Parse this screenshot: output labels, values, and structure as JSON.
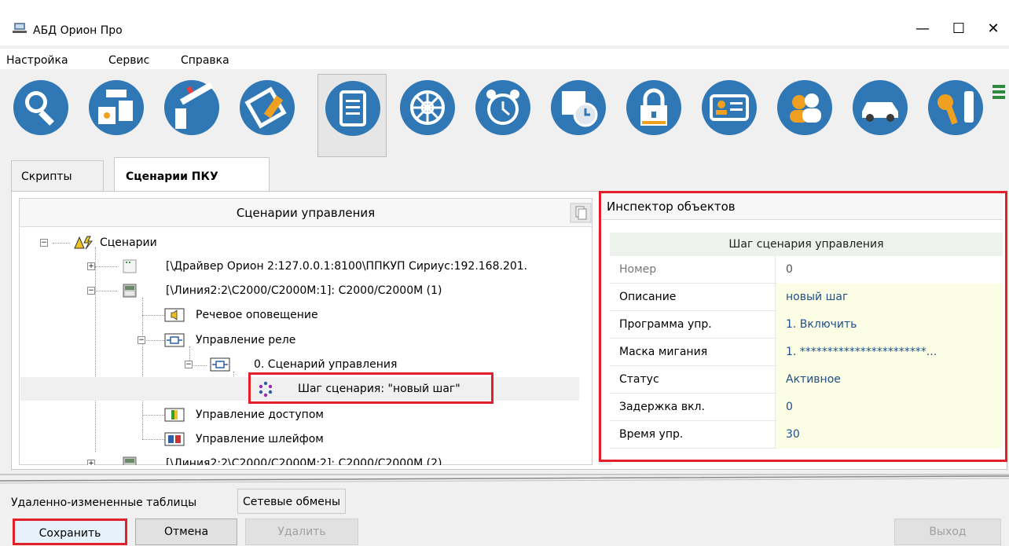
{
  "window": {
    "title": "АБД Орион Про",
    "minimize": "—",
    "maximize": "☐",
    "close": "✕"
  },
  "menu": [
    "Настройка",
    "Сервис",
    "Справка"
  ],
  "toolbar": {
    "buttons": [
      {
        "icon": "search-icon"
      },
      {
        "icon": "devices-icon"
      },
      {
        "icon": "barrier-icon"
      },
      {
        "icon": "floor-plan-icon"
      },
      {
        "icon": "document-icon",
        "active": true
      },
      {
        "icon": "wheel-icon"
      },
      {
        "icon": "alarm-clock-icon"
      },
      {
        "icon": "schedule-icon"
      },
      {
        "icon": "padlock-icon"
      },
      {
        "icon": "id-card-icon"
      },
      {
        "icon": "users-icon"
      },
      {
        "icon": "car-icon"
      },
      {
        "icon": "key-icon"
      }
    ],
    "accent_color": "#2f77b5"
  },
  "tabs": {
    "scripts": "Скрипты",
    "pku_scenarios": "Сценарии ПКУ"
  },
  "tree_panel": {
    "header": "Сценарии управления",
    "items": {
      "root": "Сценарии",
      "driver": "[\\Драйвер Орион 2:127.0.0.1:8100\\ППКУП Сириус:192.168.201.",
      "line1": "[\\Линия2:2\\С2000/С2000М:1]: С2000/С2000М (1)",
      "voice": "Речевое оповещение",
      "relay": "Управление реле",
      "scenario": "0. Сценарий управления",
      "step": "Шаг сценария: \"новый шаг\"",
      "access": "Управление доступом",
      "loop": "Управление шлейфом",
      "line2": "[\\Линия2:2\\С2000/С2000М:2]: С2000/С2000М (2)"
    }
  },
  "inspector": {
    "header": "Инспектор объектов",
    "subheader": "Шаг сценария управления",
    "rows": [
      {
        "label": "Номер",
        "value": "0"
      },
      {
        "label": "Описание",
        "value": "новый шаг"
      },
      {
        "label": "Программа упр.",
        "value": "1. Включить"
      },
      {
        "label": "Маска мигания",
        "value": "1. ***********************..."
      },
      {
        "label": "Статус",
        "value": "Активное"
      },
      {
        "label": "Задержка вкл.",
        "value": "0"
      },
      {
        "label": "Время упр.",
        "value": "30"
      }
    ]
  },
  "bottom_tabs": [
    "Удаленно-измененные таблицы",
    "Сетевые обмены"
  ],
  "buttons": {
    "save": "Сохранить",
    "cancel": "Отмена",
    "delete": "Удалить",
    "exit": "Выход"
  },
  "colors": {
    "highlight": "#e2202a",
    "value_text": "#1e4e8c",
    "value_bg": "#fbfde5"
  }
}
